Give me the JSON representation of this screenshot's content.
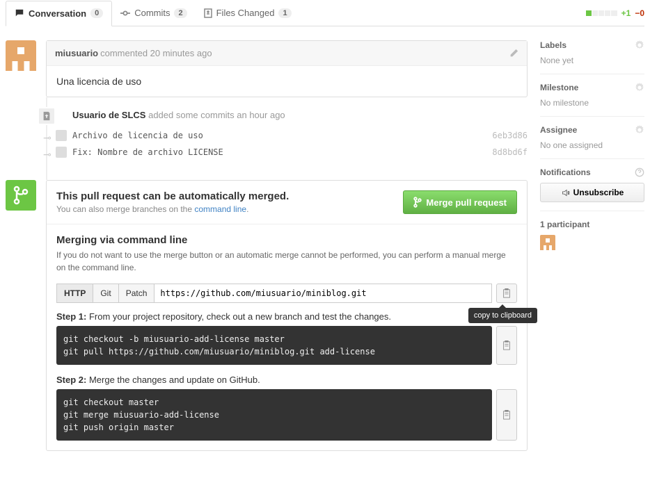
{
  "tabs": {
    "conversation": {
      "label": "Conversation",
      "count": "0"
    },
    "commits": {
      "label": "Commits",
      "count": "2"
    },
    "files": {
      "label": "Files Changed",
      "count": "1"
    },
    "additions": "+1",
    "deletions": "−0"
  },
  "comment": {
    "user": "miusuario",
    "meta": "commented 20 minutes ago",
    "body": "Una licencia de uso"
  },
  "push_event": {
    "actor": "Usuario de SLCS",
    "text": "added some commits an hour ago"
  },
  "commits": [
    {
      "msg": "Archivo de licencia de uso",
      "sha": "6eb3d86"
    },
    {
      "msg": "Fix: Nombre de archivo LICENSE",
      "sha": "8d8bd6f"
    }
  ],
  "merge": {
    "title": "This pull request can be automatically merged.",
    "subtitle_pre": "You can also merge branches on the ",
    "subtitle_link": "command line",
    "button": "Merge pull request",
    "cli_title": "Merging via command line",
    "cli_desc": "If you do not want to use the merge button or an automatic merge cannot be performed, you can perform a manual merge on the command line.",
    "proto": {
      "http": "HTTP",
      "git": "Git",
      "patch": "Patch"
    },
    "url": "https://github.com/miusuario/miniblog.git",
    "tooltip": "copy to clipboard",
    "step1_label": "Step 1:",
    "step1_text": " From your project repository, check out a new branch and test the changes.",
    "step1_code": "git checkout -b miusuario-add-license master\ngit pull https://github.com/miusuario/miniblog.git add-license",
    "step2_label": "Step 2:",
    "step2_text": " Merge the changes and update on GitHub.",
    "step2_code": "git checkout master\ngit merge miusuario-add-license\ngit push origin master"
  },
  "sidebar": {
    "labels_h": "Labels",
    "labels_v": "None yet",
    "milestone_h": "Milestone",
    "milestone_v": "No milestone",
    "assignee_h": "Assignee",
    "assignee_v": "No one assigned",
    "notif_h": "Notifications",
    "unsubscribe": "Unsubscribe",
    "participants": "1 participant"
  }
}
